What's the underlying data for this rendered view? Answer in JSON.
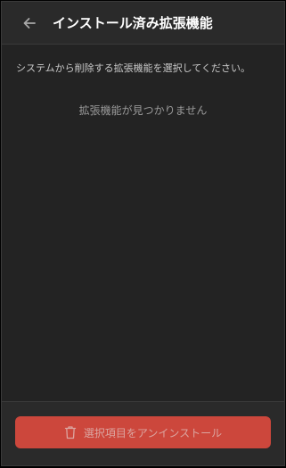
{
  "header": {
    "back_icon": "arrow-left-icon",
    "title": "インストール済み拡張機能"
  },
  "main": {
    "instruction": "システムから削除する拡張機能を選択してください。",
    "empty_message": "拡張機能が見つかりません"
  },
  "footer": {
    "uninstall_icon": "trash-icon",
    "uninstall_label": "選択項目をアンインストール"
  },
  "colors": {
    "background": "#232323",
    "header_background": "#2a2a2a",
    "accent_danger": "#e34b3f"
  }
}
